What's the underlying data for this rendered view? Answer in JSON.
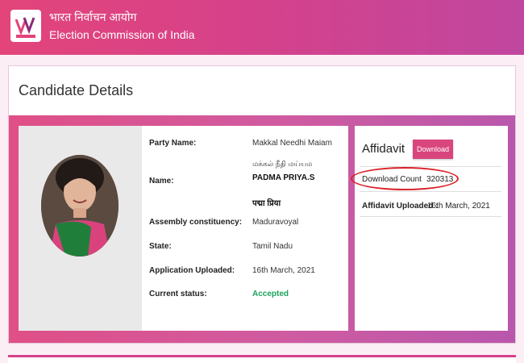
{
  "header": {
    "brand_hindi": "भारत निर्वाचन आयोग",
    "brand_english": "Election Commission of India",
    "logo_icon": "ballot-box-logo-icon",
    "gradient": [
      "#e3457a",
      "#c0479f"
    ]
  },
  "candidate": {
    "section_title": "Candidate Details",
    "photo_icon": "candidate-photo",
    "fields": {
      "party_label": "Party Name:",
      "party_value": "Makkal Needhi Maiam",
      "name_label": "Name:",
      "name_tamil": "மக்கல் நீதி மய்யம",
      "name_value": "PADMA PRIYA.S",
      "name_hindi": "पद्मा प्रिया",
      "constituency_label": "Assembly constituency:",
      "constituency_value": "Maduravoyal",
      "state_label": "State:",
      "state_value": "Tamil Nadu",
      "application_label": "Application Uploaded:",
      "application_value": "16th March, 2021",
      "status_label": "Current status:",
      "status_value": "Accepted",
      "status_color": "#19a15b"
    }
  },
  "affidavit": {
    "title": "Affidavit",
    "download_button": "Download",
    "download_count_label": "Download Count",
    "download_count_value": "320313",
    "uploaded_label": "Affidavit Uploaded :",
    "uploaded_value": "16th March, 2021",
    "highlight_color": "#d9232b"
  }
}
